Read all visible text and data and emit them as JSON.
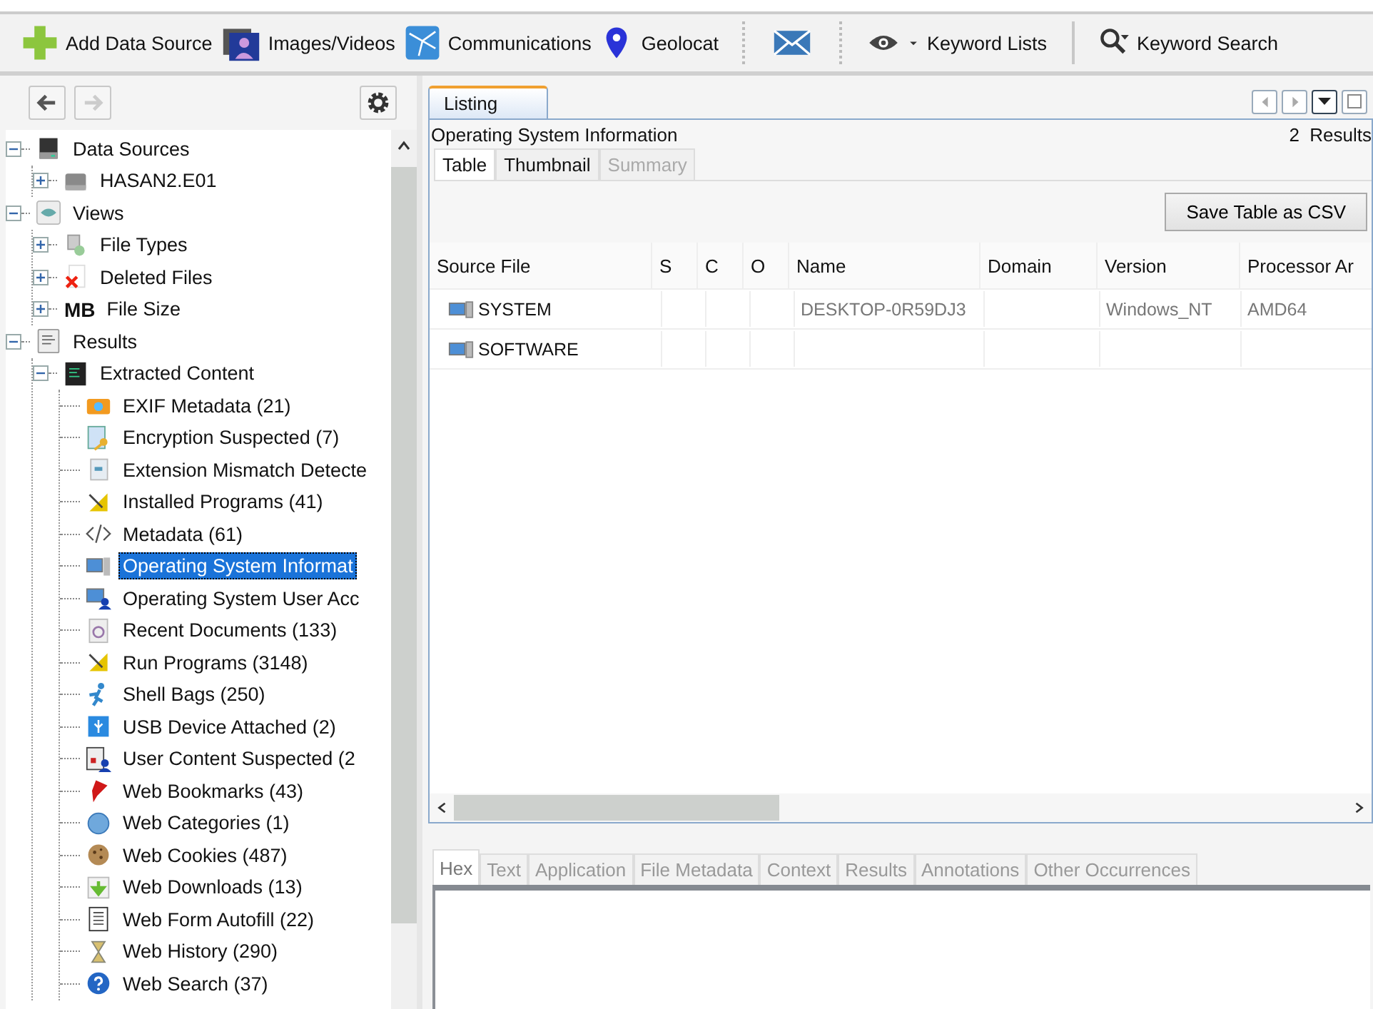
{
  "toolbar": {
    "items": [
      {
        "kind": "plus",
        "label": "Add Data Source"
      },
      {
        "kind": "images",
        "label": "Images/Videos"
      },
      {
        "kind": "network",
        "label": "Communications"
      },
      {
        "kind": "pin",
        "label": "Geolocat"
      },
      {
        "kind": "mail"
      },
      {
        "kind": "eye",
        "label": "Keyword Lists"
      },
      {
        "kind": "search",
        "label": "Keyword Search"
      }
    ]
  },
  "tree": [
    {
      "label": "Data Sources",
      "expanded": true,
      "selected": false,
      "children": [
        {
          "label": "HASAN2.E01",
          "expanded": false,
          "selected": false
        }
      ]
    },
    {
      "label": "Views",
      "expanded": true,
      "selected": false,
      "children": [
        {
          "label": "File Types",
          "expanded": false,
          "selected": false
        },
        {
          "label": "Deleted Files",
          "expanded": false,
          "selected": false
        },
        {
          "label": "File Size",
          "badge": "MB",
          "expanded": false,
          "selected": false
        }
      ]
    },
    {
      "label": "Results",
      "expanded": true,
      "selected": false,
      "children": [
        {
          "label": "Extracted Content",
          "expanded": true,
          "selected": false,
          "children": [
            {
              "label": "EXIF Metadata (21)",
              "selected": false
            },
            {
              "label": "Encryption Suspected (7)",
              "selected": false
            },
            {
              "label": "Extension Mismatch Detecte",
              "selected": false
            },
            {
              "label": "Installed Programs (41)",
              "selected": false
            },
            {
              "label": "Metadata (61)",
              "selected": false
            },
            {
              "label": "Operating System Informat",
              "selected": true
            },
            {
              "label": "Operating System User Acc",
              "selected": false
            },
            {
              "label": "Recent Documents (133)",
              "selected": false
            },
            {
              "label": "Run Programs (3148)",
              "selected": false
            },
            {
              "label": "Shell Bags (250)",
              "selected": false
            },
            {
              "label": "USB Device Attached (2)",
              "selected": false
            },
            {
              "label": "User Content Suspected (2",
              "selected": false
            },
            {
              "label": "Web Bookmarks (43)",
              "selected": false
            },
            {
              "label": "Web Categories (1)",
              "selected": false
            },
            {
              "label": "Web Cookies (487)",
              "selected": false
            },
            {
              "label": "Web Downloads (13)",
              "selected": false
            },
            {
              "label": "Web Form Autofill (22)",
              "selected": false
            },
            {
              "label": "Web History (290)",
              "selected": false
            },
            {
              "label": "Web Search (37)",
              "selected": false
            }
          ]
        }
      ]
    }
  ],
  "listing": {
    "tab": "Listing",
    "title": "Operating System Information",
    "results": "2  Results",
    "view_tabs": [
      {
        "label": "Table",
        "selected": true,
        "disabled": false
      },
      {
        "label": "Thumbnail",
        "selected": false,
        "disabled": false
      },
      {
        "label": "Summary",
        "selected": false,
        "disabled": true
      }
    ],
    "save_button": "Save Table as CSV",
    "columns": [
      "Source File",
      "S",
      "C",
      "O",
      "Name",
      "Domain",
      "Version",
      "Processor Ar"
    ],
    "rows": [
      {
        "cells": [
          "SYSTEM",
          null,
          null,
          null,
          "DESKTOP-0R59DJ3",
          null,
          "Windows_NT",
          "AMD64"
        ]
      },
      {
        "cells": [
          "SOFTWARE",
          null,
          null,
          null,
          null,
          null,
          null,
          null
        ]
      }
    ]
  },
  "content_tabs": [
    {
      "label": "Hex",
      "selected": true
    },
    {
      "label": "Text",
      "selected": false
    },
    {
      "label": "Application",
      "selected": false
    },
    {
      "label": "File Metadata",
      "selected": false
    },
    {
      "label": "Context",
      "selected": false
    },
    {
      "label": "Results",
      "selected": false
    },
    {
      "label": "Annotations",
      "selected": false
    },
    {
      "label": "Other Occurrences",
      "selected": false
    }
  ]
}
